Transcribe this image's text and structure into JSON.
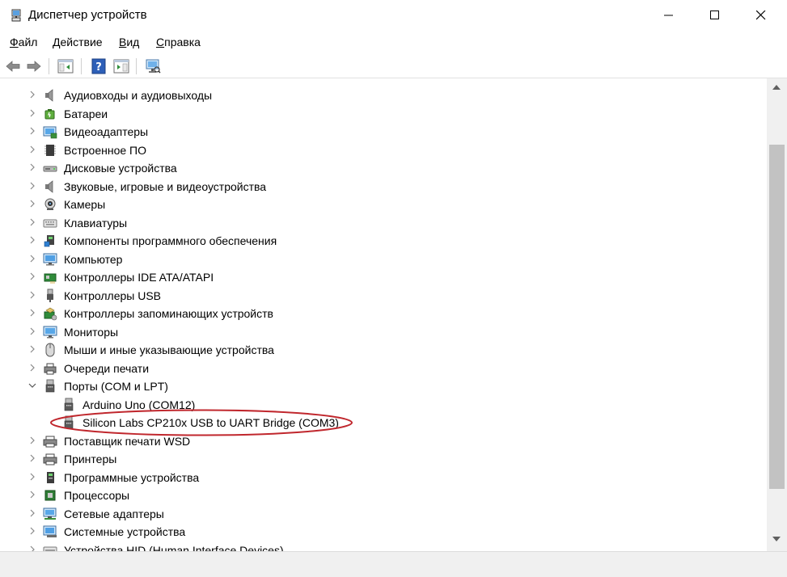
{
  "window": {
    "title": "Диспетчер устройств"
  },
  "menu": [
    {
      "label": "Файл",
      "hotkey": "Ф",
      "rest": "айл"
    },
    {
      "label": "Действие",
      "hotkey": "Д",
      "rest": "ействие"
    },
    {
      "label": "Вид",
      "hotkey": "В",
      "rest": "ид"
    },
    {
      "label": "Справка",
      "hotkey": "С",
      "rest": "правка"
    }
  ],
  "tree": {
    "items": [
      {
        "label": "Аудиовходы и аудиовыходы",
        "icon": "speaker-icon",
        "expanded": false
      },
      {
        "label": "Батареи",
        "icon": "battery-icon",
        "expanded": false
      },
      {
        "label": "Видеоадаптеры",
        "icon": "display-adapter-icon",
        "expanded": false
      },
      {
        "label": "Встроенное ПО",
        "icon": "firmware-chip-icon",
        "expanded": false
      },
      {
        "label": "Дисковые устройства",
        "icon": "disk-drive-icon",
        "expanded": false
      },
      {
        "label": "Звуковые, игровые и видеоустройства",
        "icon": "speaker-icon",
        "expanded": false
      },
      {
        "label": "Камеры",
        "icon": "webcam-icon",
        "expanded": false
      },
      {
        "label": "Клавиатуры",
        "icon": "keyboard-icon",
        "expanded": false
      },
      {
        "label": "Компоненты программного обеспечения",
        "icon": "software-component-icon",
        "expanded": false
      },
      {
        "label": "Компьютер",
        "icon": "computer-icon",
        "expanded": false
      },
      {
        "label": "Контроллеры IDE ATA/ATAPI",
        "icon": "ide-controller-icon",
        "expanded": false
      },
      {
        "label": "Контроллеры USB",
        "icon": "usb-plug-icon",
        "expanded": false
      },
      {
        "label": "Контроллеры запоминающих устройств",
        "icon": "storage-controller-icon",
        "expanded": false
      },
      {
        "label": "Мониторы",
        "icon": "monitor-icon",
        "expanded": false
      },
      {
        "label": "Мыши и иные указывающие устройства",
        "icon": "mouse-icon",
        "expanded": false
      },
      {
        "label": "Очереди печати",
        "icon": "print-queue-icon",
        "expanded": false
      },
      {
        "label": "Порты (COM и LPT)",
        "icon": "port-icon",
        "expanded": true
      },
      {
        "label": "Arduino Uno (COM12)",
        "icon": "port-icon",
        "child": true
      },
      {
        "label": "Silicon Labs CP210x USB to UART Bridge (COM3)",
        "icon": "port-icon",
        "child": true
      },
      {
        "label": "Поставщик печати WSD",
        "icon": "printer-icon",
        "expanded": false
      },
      {
        "label": "Принтеры",
        "icon": "printer-icon",
        "expanded": false
      },
      {
        "label": "Программные устройства",
        "icon": "software-device-icon",
        "expanded": false
      },
      {
        "label": "Процессоры",
        "icon": "processor-icon",
        "expanded": false
      },
      {
        "label": "Сетевые адаптеры",
        "icon": "network-adapter-icon",
        "expanded": false
      },
      {
        "label": "Системные устройства",
        "icon": "system-device-icon",
        "expanded": false
      },
      {
        "label": "Устройства HID (Human Interface Devices)",
        "icon": "hid-device-icon",
        "expanded": false
      }
    ]
  },
  "colors": {
    "highlight_ellipse": "#c0272d",
    "scroll_thumb": "#c2c2c2"
  }
}
